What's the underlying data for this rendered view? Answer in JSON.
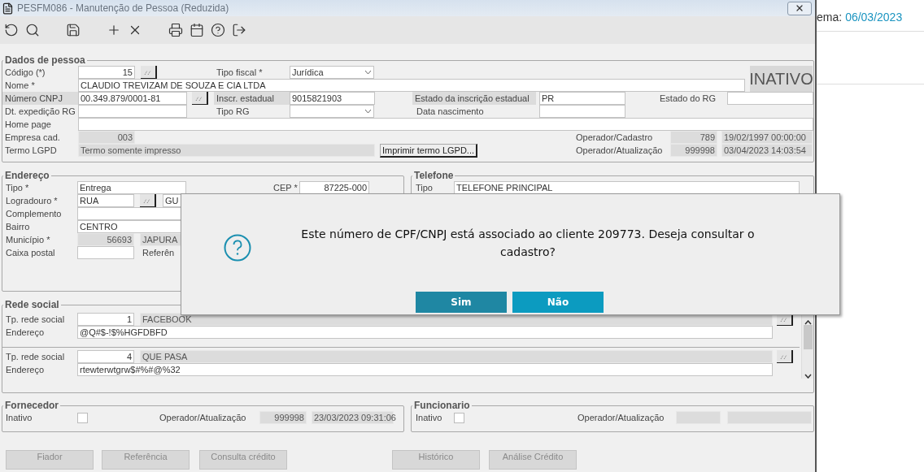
{
  "window": {
    "title": "PESFM086 - Manutenção de Pessoa (Reduzida)"
  },
  "backdrop": {
    "label": "ema:",
    "date": "06/03/2023"
  },
  "dados_pessoa": {
    "title": "Dados de pessoa",
    "status": "INATIVO",
    "rows": [
      {
        "items": [
          {
            "kind": "label",
            "text": "Código (*)"
          },
          {
            "kind": "input",
            "value": "15"
          },
          {
            "kind": "lookup"
          },
          {
            "kind": "label",
            "text": "Tipo fiscal *"
          },
          {
            "kind": "select",
            "value": "Jurídica"
          }
        ]
      },
      {
        "items": [
          {
            "kind": "label",
            "text": "Nome *"
          },
          {
            "kind": "input",
            "value": "CLAUDIO TREVIZAM DE SOUZA E CIA LTDA"
          }
        ]
      },
      {
        "items": [
          {
            "kind": "label",
            "text": "Número CNPJ"
          },
          {
            "kind": "input",
            "value": "00.349.879/0001-81"
          },
          {
            "kind": "lookup"
          },
          {
            "kind": "label",
            "text": "Inscr. estadual"
          },
          {
            "kind": "input",
            "value": "9015821903"
          },
          {
            "kind": "label",
            "text": "Estado da inscrição estadual"
          },
          {
            "kind": "input",
            "value": "PR"
          },
          {
            "kind": "label",
            "text": "Estado do RG"
          },
          {
            "kind": "input"
          }
        ]
      },
      {
        "items": [
          {
            "kind": "label",
            "text": "Dt. expedição RG"
          },
          {
            "kind": "input"
          },
          {
            "kind": "label",
            "text": "Tipo RG"
          },
          {
            "kind": "select"
          },
          {
            "kind": "label",
            "text": "Data nascimento"
          },
          {
            "kind": "input"
          }
        ]
      },
      {
        "items": [
          {
            "kind": "label",
            "text": "Home page"
          },
          {
            "kind": "input"
          }
        ]
      },
      {
        "items": [
          {
            "kind": "label",
            "text": "Empresa cad."
          },
          {
            "kind": "readonly",
            "value": "003"
          },
          {
            "kind": "label",
            "text": "Operador/Cadastro"
          },
          {
            "kind": "readonly",
            "value": "789"
          },
          {
            "kind": "readonly",
            "value": "19/02/1997 00:00:00"
          }
        ]
      },
      {
        "items": [
          {
            "kind": "label",
            "text": "Termo LGPD"
          },
          {
            "kind": "readonly",
            "value": "Termo somente impresso"
          },
          {
            "kind": "button",
            "text": "Imprimir termo LGPD..."
          },
          {
            "kind": "label",
            "text": "Operador/Atualização"
          },
          {
            "kind": "readonly",
            "value": "999998"
          },
          {
            "kind": "readonly",
            "value": "03/04/2023 14:03:54"
          }
        ]
      }
    ]
  },
  "endereco": {
    "title": "Endereço",
    "rows": [
      {
        "items": [
          {
            "kind": "label",
            "text": "Tipo *"
          },
          {
            "kind": "input",
            "value": "Entrega"
          },
          {
            "kind": "label",
            "text": "CEP *"
          },
          {
            "kind": "input",
            "value": "87225-000"
          }
        ]
      },
      {
        "items": [
          {
            "kind": "label",
            "text": "Logradouro *"
          },
          {
            "kind": "input",
            "value": "RUA"
          },
          {
            "kind": "lookup"
          },
          {
            "kind": "input",
            "value": "GU"
          }
        ]
      },
      {
        "items": [
          {
            "kind": "label",
            "text": "Complemento"
          },
          {
            "kind": "input"
          }
        ]
      },
      {
        "items": [
          {
            "kind": "label",
            "text": "Bairro"
          },
          {
            "kind": "input",
            "value": "CENTRO"
          }
        ]
      },
      {
        "items": [
          {
            "kind": "label",
            "text": "Município *"
          },
          {
            "kind": "readonly",
            "value": "56693"
          },
          {
            "kind": "readonly",
            "value": "JAPURA"
          }
        ]
      },
      {
        "items": [
          {
            "kind": "label",
            "text": "Caixa postal"
          },
          {
            "kind": "input"
          },
          {
            "kind": "label",
            "text": "Referên"
          }
        ]
      }
    ]
  },
  "telefone": {
    "title": "Telefone",
    "rows": [
      {
        "items": [
          {
            "kind": "label",
            "text": "Tipo"
          },
          {
            "kind": "input",
            "value": "TELEFONE PRINCIPAL"
          }
        ]
      }
    ]
  },
  "rede_social": {
    "title": "Rede social",
    "blocks": [
      [
        {
          "items": [
            {
              "kind": "label",
              "text": "Tp. rede social"
            },
            {
              "kind": "input",
              "value": "1"
            },
            {
              "kind": "readonly",
              "value": "FACEBOOK"
            },
            {
              "kind": "lookup"
            }
          ]
        },
        {
          "items": [
            {
              "kind": "label",
              "text": "Endereço"
            },
            {
              "kind": "input",
              "value": "@Q#$-!$%HGFDBFD"
            }
          ]
        }
      ],
      [
        {
          "items": [
            {
              "kind": "label",
              "text": "Tp. rede social"
            },
            {
              "kind": "input",
              "value": "4"
            },
            {
              "kind": "readonly",
              "value": "QUE PASA"
            },
            {
              "kind": "lookup"
            }
          ]
        },
        {
          "items": [
            {
              "kind": "label",
              "text": "Endereço"
            },
            {
              "kind": "input",
              "value": "rtewterwtgrw$#%#@%32"
            }
          ]
        }
      ]
    ]
  },
  "fornecedor": {
    "title": "Fornecedor",
    "row": {
      "items": [
        {
          "kind": "label",
          "text": "Inativo"
        },
        {
          "kind": "checkbox",
          "checked": false
        },
        {
          "kind": "label",
          "text": "Operador/Atualização"
        },
        {
          "kind": "readonly",
          "value": "999998"
        },
        {
          "kind": "readonly",
          "value": "23/03/2023 09:31:06"
        }
      ]
    }
  },
  "funcionario": {
    "title": "Funcionario",
    "row": {
      "items": [
        {
          "kind": "label",
          "text": "Inativo"
        },
        {
          "kind": "checkbox",
          "checked": false
        },
        {
          "kind": "label",
          "text": "Operador/Atualização"
        },
        {
          "kind": "readonly"
        },
        {
          "kind": "readonly"
        }
      ]
    }
  },
  "bottom_buttons": [
    "Fiador",
    "Referência",
    "Consulta crédito",
    "Histórico",
    "Análise Crédito"
  ],
  "dialog": {
    "message": "Este número de CPF/CNPJ está associado ao cliente 209773. Deseja consultar o cadastro?",
    "buttons": [
      {
        "label": "Sim",
        "selected": true
      },
      {
        "label": "Não",
        "selected": false
      }
    ]
  }
}
